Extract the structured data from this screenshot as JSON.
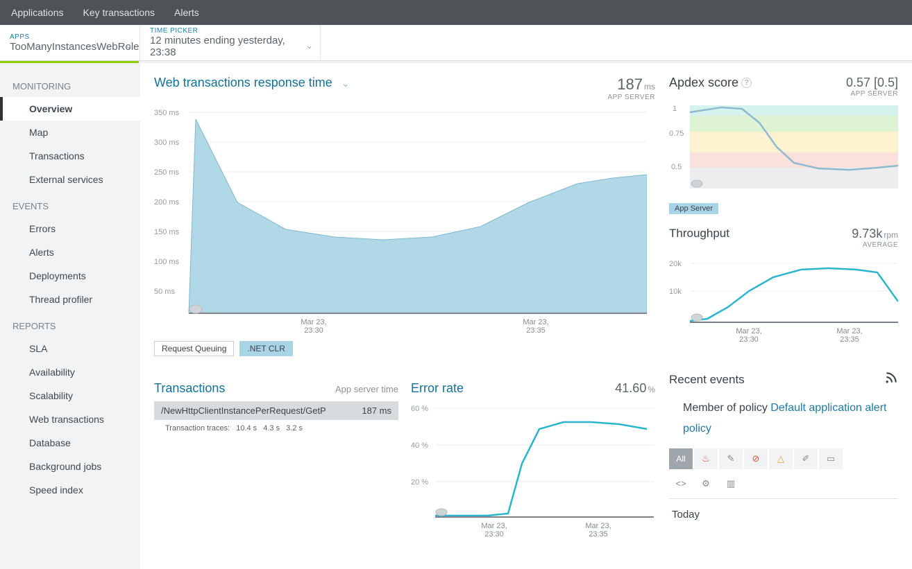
{
  "topnav": {
    "applications": "Applications",
    "key_transactions": "Key transactions",
    "alerts": "Alerts"
  },
  "subnav": {
    "apps_label": "APPS",
    "apps_value": "TooManyInstancesWebRole",
    "time_label": "TIME PICKER",
    "time_value": "12 minutes ending yesterday, 23:38"
  },
  "sidebar": {
    "monitoring_label": "MONITORING",
    "monitoring": [
      "Overview",
      "Map",
      "Transactions",
      "External services"
    ],
    "events_label": "EVENTS",
    "events": [
      "Errors",
      "Alerts",
      "Deployments",
      "Thread profiler"
    ],
    "reports_label": "REPORTS",
    "reports": [
      "SLA",
      "Availability",
      "Scalability",
      "Web transactions",
      "Database",
      "Background jobs",
      "Speed index"
    ]
  },
  "response_panel": {
    "title": "Web transactions response time",
    "value": "187",
    "unit": "ms",
    "sub": "APP SERVER",
    "legend_q": "Request Queuing",
    "legend_clr": ".NET CLR"
  },
  "apdex": {
    "title": "Apdex score",
    "value": "0.57 [0.5]",
    "sub": "APP SERVER",
    "badge": "App Server"
  },
  "throughput": {
    "title": "Throughput",
    "value": "9.73k",
    "unit": "rpm",
    "sub": "AVERAGE"
  },
  "transactions": {
    "title": "Transactions",
    "sub": "App server time",
    "row_name": "/NewHttpClientInstancePerRequest/GetP",
    "row_time": "187 ms",
    "trace_label": "Transaction traces:",
    "t1": "10.4 s",
    "t2": "4.3 s",
    "t3": "3.2 s"
  },
  "error_rate": {
    "title": "Error rate",
    "value": "41.60",
    "unit": "%"
  },
  "events_panel": {
    "title": "Recent events",
    "policy_pre": "Member of policy ",
    "policy_link": "Default application alert policy",
    "all": "All",
    "today": "Today"
  },
  "x_labels": {
    "a": "Mar 23,",
    "a2": "23:30",
    "b": "Mar 23,",
    "b2": "23:35"
  },
  "chart_data": [
    {
      "type": "area",
      "title": "Web transactions response time",
      "ylabel": "ms",
      "ylim": [
        0,
        350
      ],
      "y_ticks": [
        50,
        100,
        150,
        200,
        250,
        300,
        350
      ],
      "x": [
        "23:27",
        "23:28",
        "23:29",
        "23:30",
        "23:31",
        "23:32",
        "23:33",
        "23:34",
        "23:35",
        "23:36",
        "23:37",
        "23:38"
      ],
      "values": [
        5,
        340,
        200,
        155,
        140,
        135,
        140,
        160,
        200,
        230,
        240,
        245
      ]
    },
    {
      "type": "line",
      "title": "Apdex score",
      "ylim": [
        0,
        1
      ],
      "y_ticks": [
        0.5,
        0.75,
        1
      ],
      "x": [
        "23:27",
        "23:28",
        "23:29",
        "23:30",
        "23:31",
        "23:32",
        "23:33",
        "23:34",
        "23:35",
        "23:36",
        "23:37",
        "23:38"
      ],
      "values": [
        0.97,
        0.99,
        0.99,
        0.97,
        0.88,
        0.7,
        0.55,
        0.51,
        0.5,
        0.49,
        0.5,
        0.51
      ]
    },
    {
      "type": "line",
      "title": "Throughput",
      "ylabel": "rpm",
      "ylim": [
        0,
        20000
      ],
      "y_ticks": [
        10000,
        20000
      ],
      "x": [
        "23:27",
        "23:28",
        "23:29",
        "23:30",
        "23:31",
        "23:32",
        "23:33",
        "23:34",
        "23:35",
        "23:36",
        "23:37",
        "23:38"
      ],
      "values": [
        0,
        200,
        2000,
        5000,
        9000,
        13000,
        15500,
        16200,
        16400,
        16200,
        15800,
        8000
      ]
    },
    {
      "type": "line",
      "title": "Error rate",
      "ylabel": "%",
      "ylim": [
        0,
        60
      ],
      "y_ticks": [
        20,
        40,
        60
      ],
      "x": [
        "23:27",
        "23:28",
        "23:29",
        "23:30",
        "23:31",
        "23:32",
        "23:33",
        "23:34",
        "23:35",
        "23:36",
        "23:37",
        "23:38"
      ],
      "values": [
        0,
        0,
        0,
        0,
        2,
        30,
        48,
        50,
        50,
        49,
        47,
        46
      ]
    }
  ]
}
